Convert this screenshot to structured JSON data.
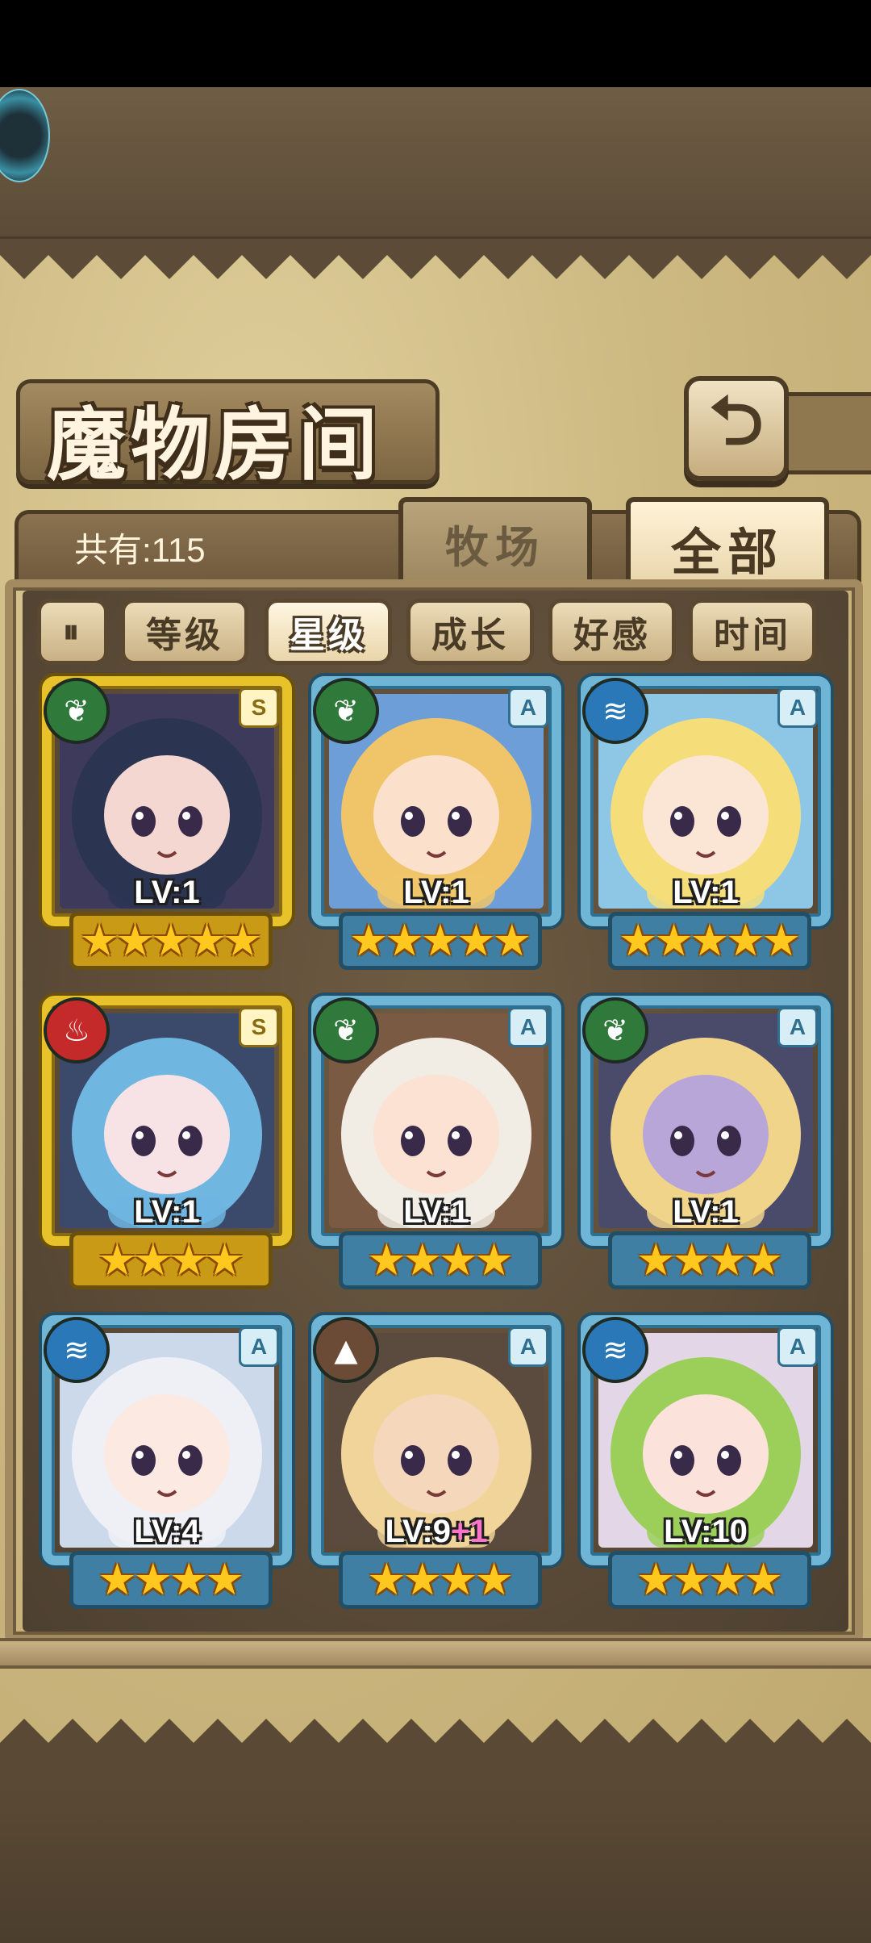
{
  "title": "魔物房间",
  "count_label": "共有:115",
  "tabs": {
    "ranch": "牧场",
    "all": "全部"
  },
  "filters": [
    {
      "label": "等级",
      "selected": false
    },
    {
      "label": "星级",
      "selected": true
    },
    {
      "label": "成长",
      "selected": false
    },
    {
      "label": "好感",
      "selected": false
    },
    {
      "label": "时间",
      "selected": false
    }
  ],
  "cards": [
    {
      "level": "LV:1",
      "rank": "S",
      "element": "leaf-icon",
      "stars": 5,
      "frame": "gold",
      "hair": "#2b3552",
      "skin": "#f4d7d0",
      "bg": "#3d3a5c"
    },
    {
      "level": "LV:1",
      "rank": "A",
      "element": "leaf-icon",
      "stars": 5,
      "frame": "blue",
      "hair": "#f0c56a",
      "skin": "#fbe1cc",
      "bg": "#6e9ed8"
    },
    {
      "level": "LV:1",
      "rank": "A",
      "element": "water-icon",
      "stars": 5,
      "frame": "blue",
      "hair": "#f5de7a",
      "skin": "#fbe6d6",
      "bg": "#8ec7e6"
    },
    {
      "level": "LV:1",
      "rank": "S",
      "element": "fire-icon",
      "stars": 4,
      "frame": "gold",
      "hair": "#6fb6e0",
      "skin": "#f7e3e6",
      "bg": "#3b4a6a"
    },
    {
      "level": "LV:1",
      "rank": "A",
      "element": "leaf-icon",
      "stars": 4,
      "frame": "blue",
      "hair": "#f1ece4",
      "skin": "#fbe2d2",
      "bg": "#7b5a44"
    },
    {
      "level": "LV:1",
      "rank": "A",
      "element": "leaf-icon",
      "stars": 4,
      "frame": "blue",
      "hair": "#f0d48a",
      "skin": "#b9a6d8",
      "bg": "#4a4a6a"
    },
    {
      "level": "LV:4",
      "rank": "A",
      "element": "water-icon",
      "stars": 4,
      "frame": "blue",
      "hair": "#eef0f6",
      "skin": "#fbe9e2",
      "bg": "#cbd9ea"
    },
    {
      "level": "LV:9",
      "level_plus": "+1",
      "rank": "A",
      "element": "earth-icon",
      "stars": 4,
      "frame": "blue",
      "hair": "#f0d49a",
      "skin": "#f5d7bb",
      "bg": "#5b4a3e"
    },
    {
      "level": "LV:10",
      "rank": "A",
      "element": "water-icon",
      "stars": 4,
      "frame": "blue",
      "hair": "#9ccf5a",
      "skin": "#fbe3dc",
      "bg": "#e3d6e6"
    }
  ],
  "element_colors": {
    "leaf-icon": "#2f7a3a",
    "water-icon": "#2a78b8",
    "fire-icon": "#c42a2a",
    "earth-icon": "#6b4a36"
  }
}
